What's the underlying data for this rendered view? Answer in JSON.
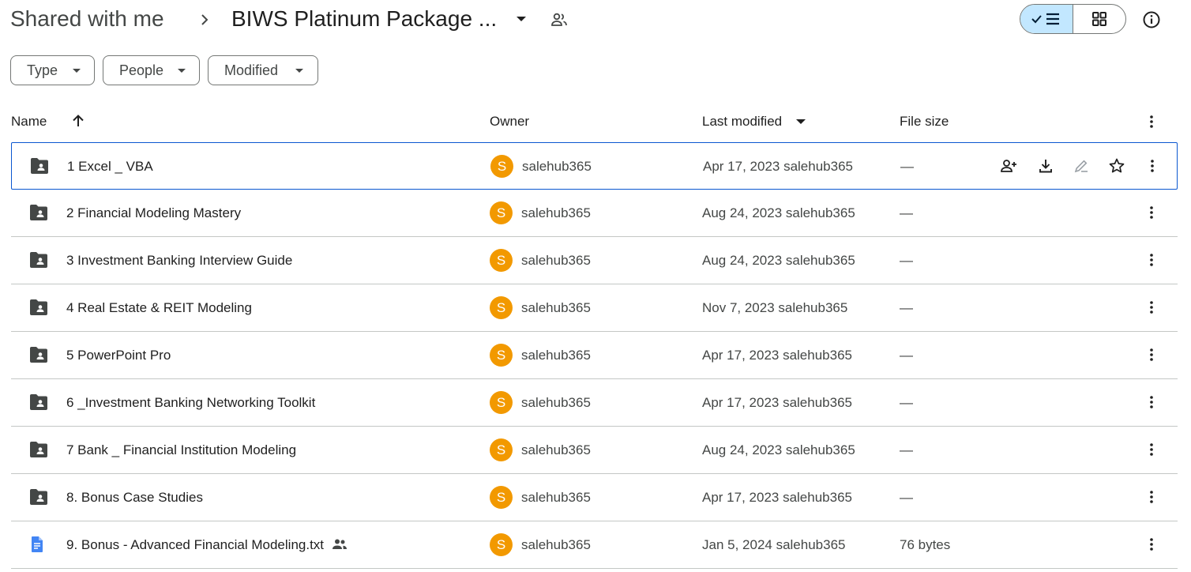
{
  "header": {
    "root_crumb": "Shared with me",
    "current_folder": "BIWS Platinum Package ...",
    "view_toggle": {
      "active": "list"
    }
  },
  "filters": [
    {
      "label": "Type"
    },
    {
      "label": "People"
    },
    {
      "label": "Modified"
    }
  ],
  "columns": {
    "name": "Name",
    "owner": "Owner",
    "last_modified": "Last modified",
    "file_size": "File size"
  },
  "rows": [
    {
      "type": "folder",
      "name": "1 Excel _ VBA",
      "owner_initial": "S",
      "owner": "salehub365",
      "modified": "Apr 17, 2023 salehub365",
      "size": "—",
      "selected": true
    },
    {
      "type": "folder",
      "name": "2  Financial Modeling Mastery",
      "owner_initial": "S",
      "owner": "salehub365",
      "modified": "Aug 24, 2023 salehub365",
      "size": "—"
    },
    {
      "type": "folder",
      "name": "3 Investment Banking Interview Guide",
      "owner_initial": "S",
      "owner": "salehub365",
      "modified": "Aug 24, 2023 salehub365",
      "size": "—"
    },
    {
      "type": "folder",
      "name": "4 Real Estate & REIT Modeling",
      "owner_initial": "S",
      "owner": "salehub365",
      "modified": "Nov 7, 2023 salehub365",
      "size": "—"
    },
    {
      "type": "folder",
      "name": "5 PowerPoint Pro",
      "owner_initial": "S",
      "owner": "salehub365",
      "modified": "Apr 17, 2023 salehub365",
      "size": "—"
    },
    {
      "type": "folder",
      "name": "6 _Investment Banking Networking Toolkit",
      "owner_initial": "S",
      "owner": "salehub365",
      "modified": "Apr 17, 2023 salehub365",
      "size": "—"
    },
    {
      "type": "folder",
      "name": "7 Bank _ Financial Institution Modeling",
      "owner_initial": "S",
      "owner": "salehub365",
      "modified": "Aug 24, 2023 salehub365",
      "size": "—"
    },
    {
      "type": "folder",
      "name": "8. Bonus Case Studies",
      "owner_initial": "S",
      "owner": "salehub365",
      "modified": "Apr 17, 2023 salehub365",
      "size": "—"
    },
    {
      "type": "doc",
      "name": "9. Bonus - Advanced Financial Modeling.txt",
      "shared": true,
      "owner_initial": "S",
      "owner": "salehub365",
      "modified": "Jan 5, 2024 salehub365",
      "size": "76 bytes"
    }
  ],
  "colors": {
    "accent": "#0b57d0",
    "toggle_active_bg": "#c2e7ff",
    "avatar": "#f29900",
    "folder_icon": "#444746",
    "doc_icon": "#4285f4",
    "divider": "#c4c7c5"
  },
  "icons": {
    "breadcrumb_separator": "chevron-right-icon",
    "folder_menu": "arrow-drop-down-icon",
    "shared_folder": "people-icon",
    "list_view": "check-list-icon",
    "grid_view": "grid-icon",
    "details": "info-icon",
    "sort": "arrow-upward-icon",
    "row_actions": [
      "share-icon",
      "download-icon",
      "rename-icon",
      "star-icon"
    ],
    "more": "more-vert-icon"
  }
}
